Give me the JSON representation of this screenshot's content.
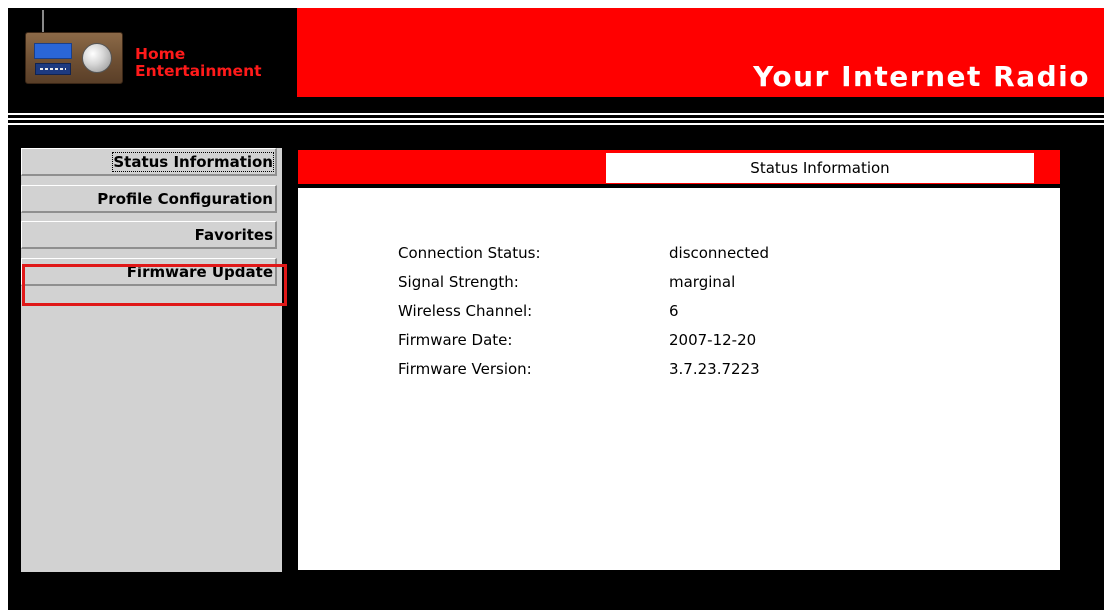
{
  "header": {
    "brand_line1": "Home",
    "brand_line2": "Entertainment",
    "title": "Your Internet Radio",
    "brand_color": "#ff0000"
  },
  "sidebar": {
    "items": [
      {
        "label": "Status Information",
        "selected": true
      },
      {
        "label": "Profile Configuration",
        "selected": false
      },
      {
        "label": "Favorites",
        "selected": false
      },
      {
        "label": "Firmware Update",
        "selected": false
      }
    ],
    "highlighted_item": "Firmware Update",
    "highlight_color": "#e01818"
  },
  "main": {
    "tab_label": "Status Information",
    "status_rows": [
      {
        "label": "Connection Status:",
        "value": "disconnected"
      },
      {
        "label": "Signal Strength:",
        "value": "marginal"
      },
      {
        "label": "Wireless Channel:",
        "value": "6"
      },
      {
        "label": "Firmware Date:",
        "value": "2007-12-20"
      },
      {
        "label": "Firmware Version:",
        "value": "3.7.23.7223"
      }
    ]
  },
  "icons": [
    "radio-logo-icon"
  ]
}
